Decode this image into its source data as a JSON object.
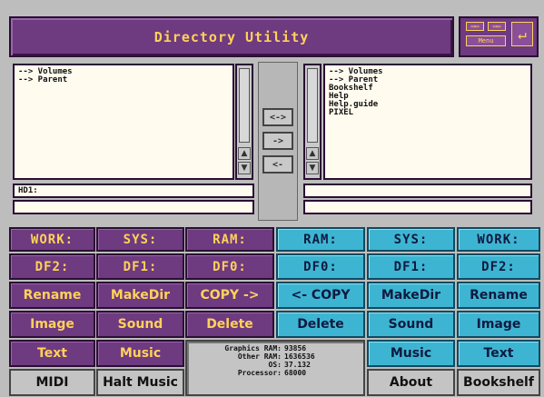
{
  "window": {
    "title": "Directory Utility",
    "menu_label": "Menu"
  },
  "left_pane": {
    "items": [
      "--> Volumes",
      "--> Parent"
    ],
    "path": "HD1:"
  },
  "right_pane": {
    "items": [
      "--> Volumes",
      "--> Parent",
      "Bookshelf",
      "Help",
      "Help.guide",
      "PIXEL"
    ],
    "path": ""
  },
  "transfer": {
    "both": "<->",
    "right": "->",
    "left": "<-"
  },
  "left_buttons": {
    "row1": [
      "WORK:",
      "SYS:",
      "RAM:"
    ],
    "row2": [
      "DF2:",
      "DF1:",
      "DF0:"
    ],
    "row3": [
      "Rename",
      "MakeDir",
      "COPY ->"
    ],
    "row4": [
      "Image",
      "Sound",
      "Delete"
    ],
    "row5": [
      "Text",
      "Music"
    ],
    "row6": [
      "MIDI",
      "Halt Music"
    ]
  },
  "right_buttons": {
    "row1": [
      "RAM:",
      "SYS:",
      "WORK:"
    ],
    "row2": [
      "DF0:",
      "DF1:",
      "DF2:"
    ],
    "row3": [
      "<- COPY",
      "MakeDir",
      "Rename"
    ],
    "row4": [
      "Delete",
      "Sound",
      "Image"
    ],
    "row5": [
      "Music",
      "Text"
    ],
    "row6": [
      "About",
      "Bookshelf"
    ]
  },
  "status": {
    "graphics_ram_label": "Graphics RAM:",
    "graphics_ram": "93856",
    "other_ram_label": "Other RAM:",
    "other_ram": "1636536",
    "os_label": "OS:",
    "os": "37.132",
    "processor_label": "Processor:",
    "processor": "68000"
  },
  "colors": {
    "purple": "#6e3a80",
    "cyan": "#3db5d2",
    "accent_yellow": "#ffd25a"
  }
}
